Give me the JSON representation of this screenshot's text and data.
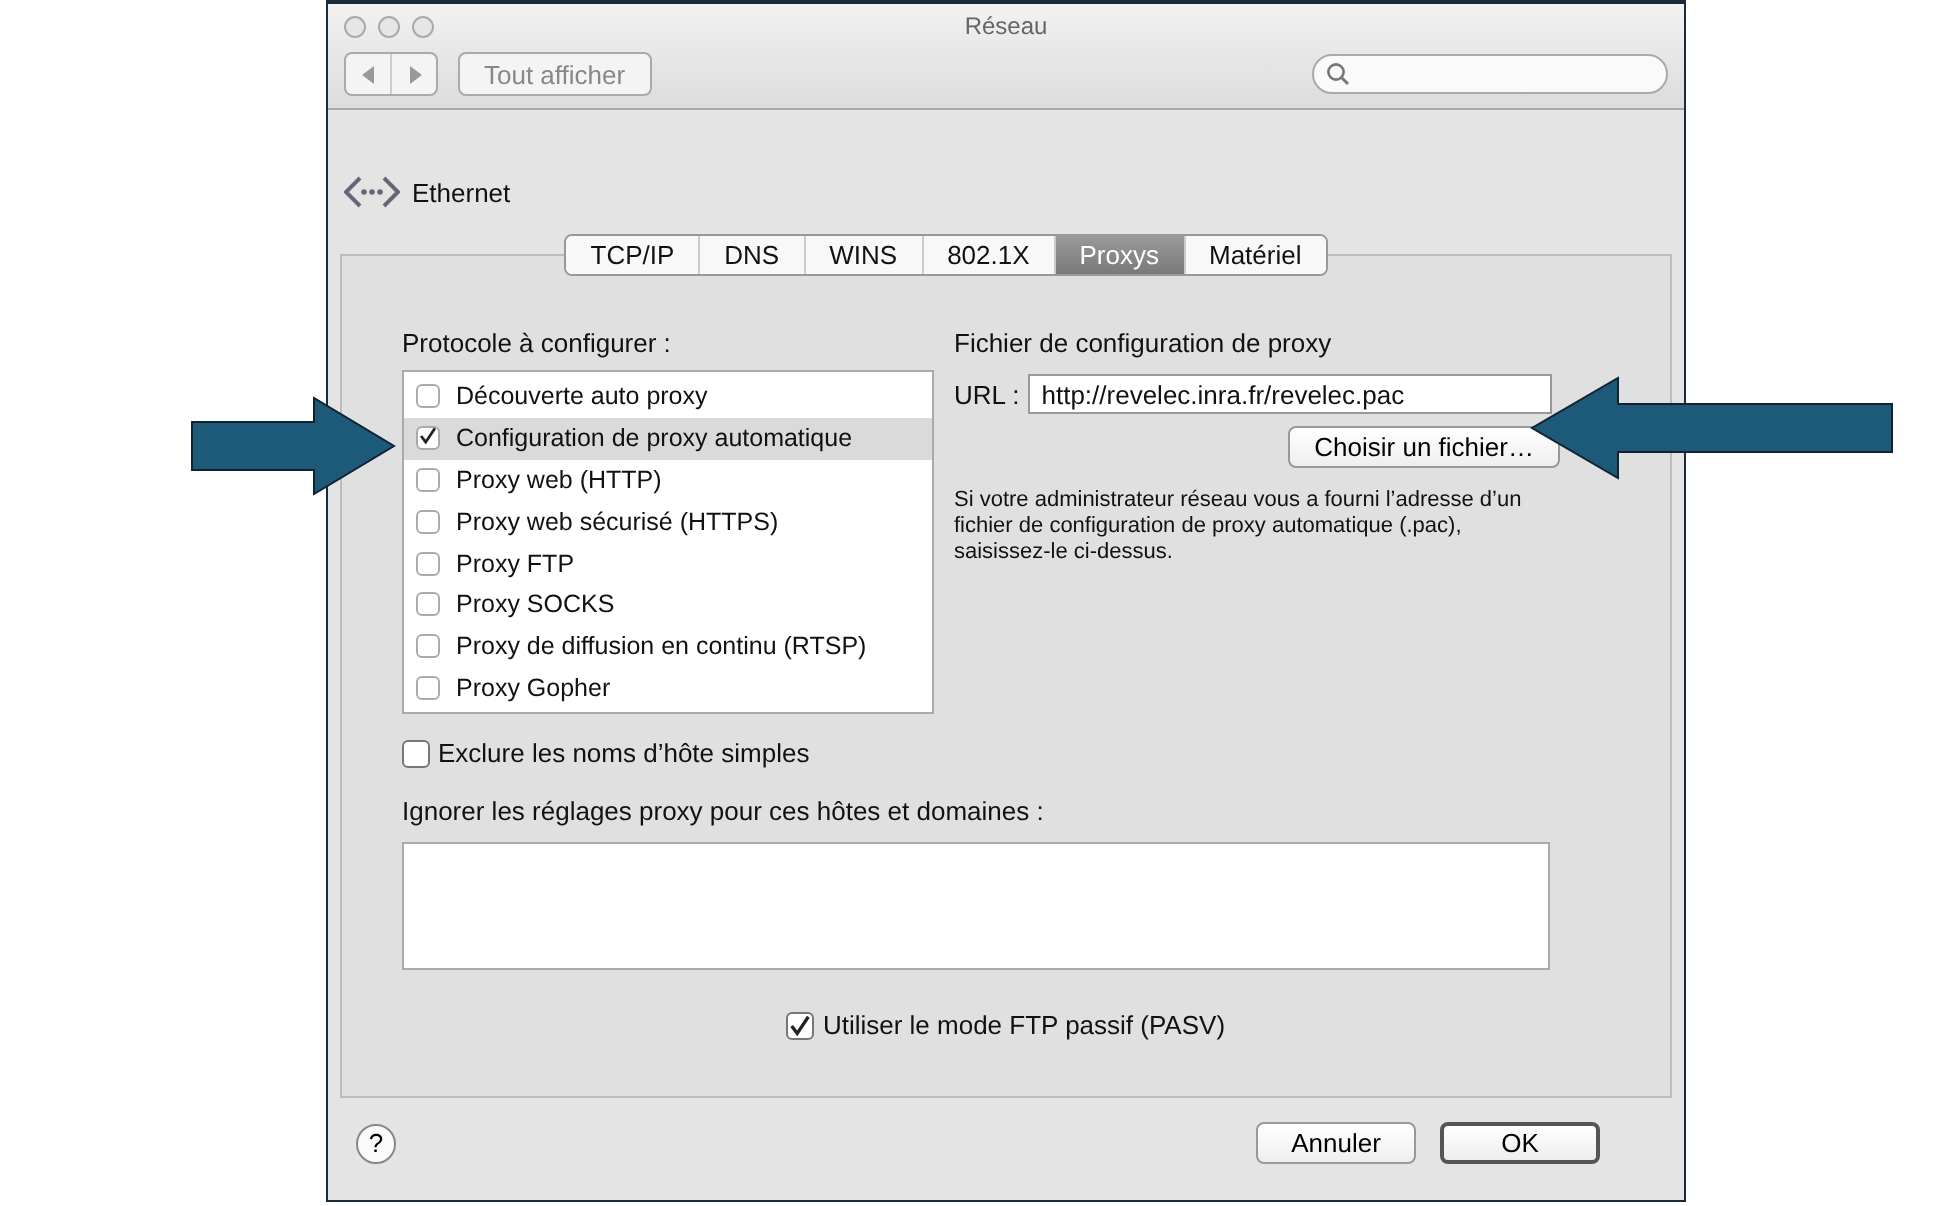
{
  "window": {
    "title": "Réseau"
  },
  "toolbar": {
    "show_all_button": "Tout afficher"
  },
  "service": {
    "name": "Ethernet"
  },
  "tabs": [
    {
      "label": "TCP/IP",
      "selected": false
    },
    {
      "label": "DNS",
      "selected": false
    },
    {
      "label": "WINS",
      "selected": false
    },
    {
      "label": "802.1X",
      "selected": false
    },
    {
      "label": "Proxys",
      "selected": true
    },
    {
      "label": "Matériel",
      "selected": false
    }
  ],
  "protocols": {
    "label": "Protocole à configurer :",
    "items": [
      {
        "label": "Découverte auto proxy",
        "checked": false,
        "selected": false
      },
      {
        "label": "Configuration de proxy automatique",
        "checked": true,
        "selected": true
      },
      {
        "label": "Proxy web (HTTP)",
        "checked": false,
        "selected": false
      },
      {
        "label": "Proxy web sécurisé (HTTPS)",
        "checked": false,
        "selected": false
      },
      {
        "label": "Proxy FTP",
        "checked": false,
        "selected": false
      },
      {
        "label": "Proxy SOCKS",
        "checked": false,
        "selected": false
      },
      {
        "label": "Proxy de diffusion en continu (RTSP)",
        "checked": false,
        "selected": false
      },
      {
        "label": "Proxy Gopher",
        "checked": false,
        "selected": false
      }
    ]
  },
  "pac": {
    "label": "Fichier de configuration de proxy",
    "url_label": "URL :",
    "url": "http://revelec.inra.fr/revelec.pac",
    "choose_button": "Choisir un fichier…",
    "help_text": "Si votre administrateur réseau vous a fourni l’adresse d’un fichier de configuration de proxy automatique (.pac), saisissez-le ci-dessus."
  },
  "exclude_simple_hosts": {
    "label": "Exclure les noms d’hôte simples",
    "checked": false
  },
  "bypass": {
    "label": "Ignorer les réglages proxy pour ces hôtes et domaines :"
  },
  "passive_ftp": {
    "label": "Utiliser le mode FTP passif (PASV)",
    "checked": true
  },
  "help_button": "?",
  "buttons": [
    {
      "label": "Annuler",
      "default": false
    },
    {
      "label": "OK",
      "default": true
    }
  ]
}
